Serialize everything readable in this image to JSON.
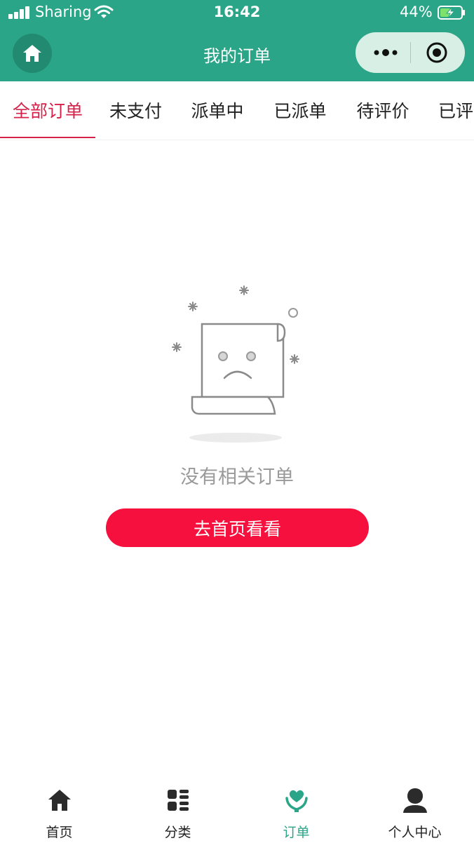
{
  "status_bar": {
    "carrier": "Sharing",
    "time": "16:42",
    "battery": "44%"
  },
  "header": {
    "title": "我的订单",
    "home_icon": "home-icon",
    "menu_icon": "more-dots-icon",
    "close_icon": "miniapp-close-icon"
  },
  "tabs": [
    {
      "label": "全部订单",
      "active": true
    },
    {
      "label": "未支付"
    },
    {
      "label": "派单中"
    },
    {
      "label": "已派单"
    },
    {
      "label": "待评价"
    },
    {
      "label": "已评"
    }
  ],
  "empty_state": {
    "illustration": "sad-document-icon",
    "message": "没有相关订单",
    "button_label": "去首页看看"
  },
  "bottom_nav": [
    {
      "label": "首页",
      "icon": "home-icon"
    },
    {
      "label": "分类",
      "icon": "grid-icon"
    },
    {
      "label": "订单",
      "icon": "heart-hand-icon",
      "active": true
    },
    {
      "label": "个人中心",
      "icon": "user-icon"
    }
  ],
  "colors": {
    "header_green": "#2ba587",
    "accent_red": "#d6224b",
    "button_red": "#f5103d"
  }
}
